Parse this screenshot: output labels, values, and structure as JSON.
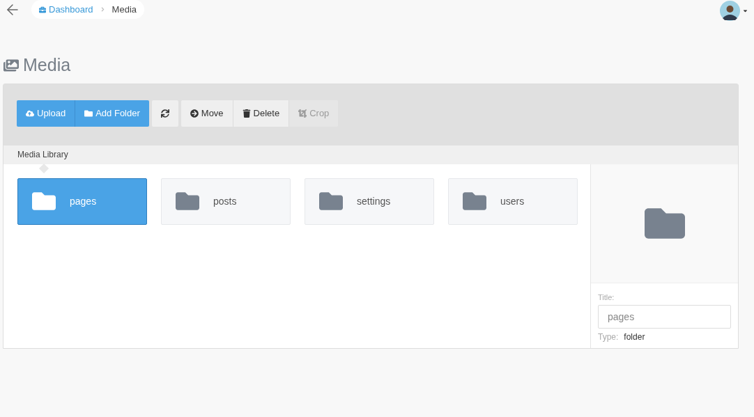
{
  "breadcrumb": [
    {
      "label": "Dashboard",
      "kind": "link"
    },
    {
      "label": "Media",
      "kind": "current"
    }
  ],
  "page_title": "Media",
  "toolbar": [
    {
      "kind": "primary",
      "buttons": [
        {
          "label": "Upload",
          "kind": "upload",
          "disabled": false
        },
        {
          "label": "Add Folder",
          "kind": "folder",
          "disabled": false
        }
      ]
    },
    {
      "kind": "default",
      "buttons": [
        {
          "kind": "refresh",
          "disabled": false
        }
      ]
    },
    {
      "kind": "default",
      "buttons": [
        {
          "label": "Move",
          "kind": "move",
          "disabled": false
        },
        {
          "label": "Delete",
          "kind": "delete",
          "disabled": false
        },
        {
          "label": "Crop",
          "kind": "crop",
          "disabled": true
        }
      ]
    }
  ],
  "library_label": "Media Library",
  "folders": [
    {
      "name": "pages",
      "selected": true
    },
    {
      "name": "posts",
      "selected": false
    },
    {
      "name": "settings",
      "selected": false
    },
    {
      "name": "users",
      "selected": false
    }
  ],
  "details": {
    "title_label": "Title:",
    "title_value": "pages",
    "type_label": "Type:",
    "type_value": "folder"
  }
}
